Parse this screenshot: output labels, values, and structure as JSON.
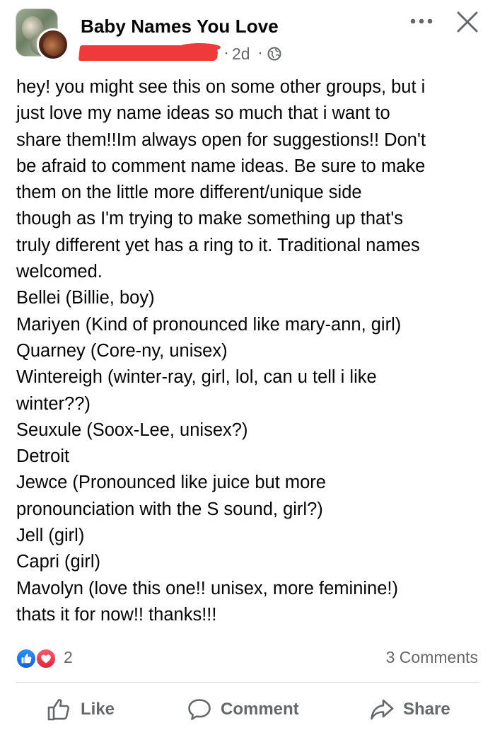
{
  "header": {
    "group_name": "Baby Names You Love",
    "time": "2d",
    "separator": "·",
    "visibility_icon": "globe-icon",
    "more_icon": "more-dots-icon",
    "close_icon": "close-icon"
  },
  "post": {
    "lines": [
      "hey! you might see this on some other groups, but i",
      "just love my name ideas so much that i want to",
      "share them!!Im always open for suggestions!! Don't",
      "be afraid to comment name ideas. Be sure to make",
      "them on the little more different/unique side",
      "though as I'm trying to make something up that's",
      "truly different yet has a ring to it. Traditional names",
      "welcomed.",
      "Bellei (Billie, boy)",
      "Mariyen (Kind of pronounced like mary-ann, girl)",
      "Quarney (Core-ny, unisex)",
      "Wintereigh (winter-ray, girl, lol, can u tell i like",
      "winter??)",
      "Seuxule (Soox-Lee, unisex?)",
      "Detroit",
      "Jewce (Pronounced like juice but more",
      "pronounciation with the S sound, girl?)",
      "Jell (girl)",
      "Capri (girl)",
      "Mavolyn (love this one!! unisex, more feminine!)",
      "thats it for now!! thanks!!!"
    ]
  },
  "reactions": {
    "count": "2",
    "comments": "3 Comments",
    "icons": [
      "like-reaction-icon",
      "love-reaction-icon"
    ]
  },
  "actions": {
    "like": "Like",
    "comment": "Comment",
    "share": "Share"
  },
  "colors": {
    "text": "#050505",
    "secondary": "#65676b",
    "like_blue": "#1877f2",
    "love_red": "#f33e58",
    "redaction": "#f0393a"
  }
}
